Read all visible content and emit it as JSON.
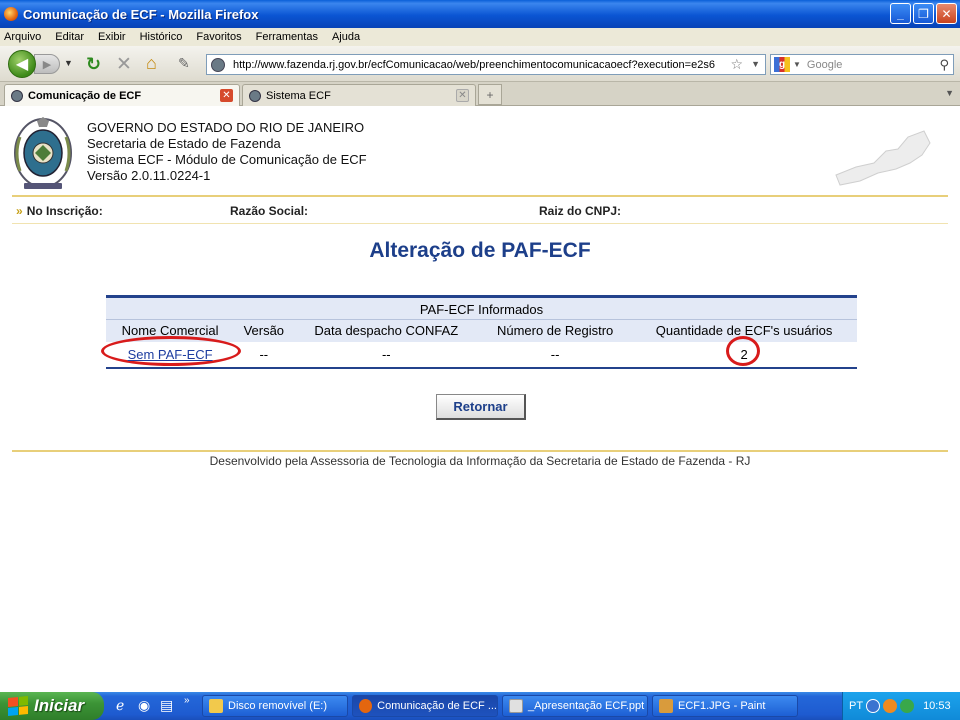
{
  "window": {
    "title": "Comunicação de ECF - Mozilla Firefox"
  },
  "menu": [
    "Arquivo",
    "Editar",
    "Exibir",
    "Histórico",
    "Favoritos",
    "Ferramentas",
    "Ajuda"
  ],
  "nav": {
    "url": "http://www.fazenda.rj.gov.br/ecfComunicacao/web/preenchimentocomunicacaoecf?execution=e2s6",
    "search_placeholder": "Google"
  },
  "tabs": [
    {
      "label": "Comunicação de ECF"
    },
    {
      "label": "Sistema ECF"
    }
  ],
  "header": {
    "line1": "GOVERNO DO ESTADO DO RIO DE JANEIRO",
    "line2": "Secretaria de Estado de Fazenda",
    "line3": "Sistema ECF - Módulo de Comunicação de ECF",
    "line4": "Versão 2.0.11.0224-1"
  },
  "infobar": {
    "inscricao": "No Inscrição:",
    "razao": "Razão Social:",
    "cnpj": "Raiz do CNPJ:"
  },
  "page_title": "Alteração de PAF-ECF",
  "table": {
    "caption": "PAF-ECF Informados",
    "headers": [
      "Nome Comercial",
      "Versão",
      "Data despacho CONFAZ",
      "Número de Registro",
      "Quantidade de ECF's usuários"
    ],
    "row": {
      "nome": "Sem PAF-ECF",
      "versao": "--",
      "data": "--",
      "registro": "--",
      "quantidade": "2"
    }
  },
  "button_retornar": "Retornar",
  "footer": "Desenvolvido pela Assessoria de Tecnologia da Informação da Secretaria de Estado de Fazenda - RJ",
  "taskbar": {
    "start": "Iniciar",
    "tasks": [
      "Disco removível (E:)",
      "Comunicação de ECF ...",
      "_Apresentação ECF.ppt",
      "ECF1.JPG - Paint"
    ],
    "lang": "PT",
    "clock": "10:53"
  },
  "colors": {
    "title_blue": "#1d3f8a",
    "annotation_red": "#d81b1b",
    "rule_gold": "#e8cf7a"
  }
}
